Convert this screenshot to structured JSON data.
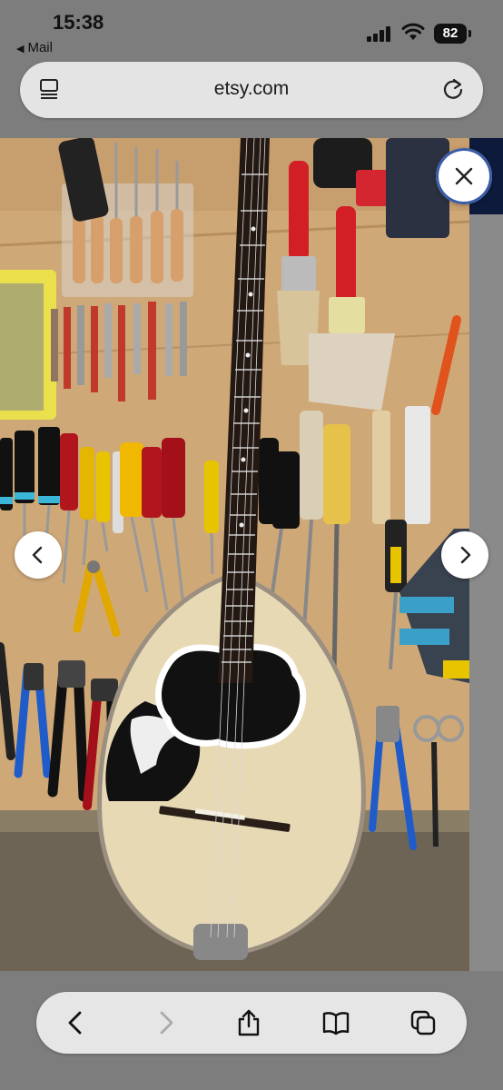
{
  "status": {
    "time": "15:38",
    "back_app": "Mail",
    "battery": "82"
  },
  "urlbar": {
    "url": "etsy.com",
    "left_icon": "reader-icon",
    "right_icon": "reload-icon"
  },
  "lightbox": {
    "image_subject": "bouzouki with eagle inlay in front of tool wall",
    "close_icon": "close-icon",
    "prev_icon": "chevron-left-icon",
    "next_icon": "chevron-right-icon"
  },
  "toolbar": {
    "icons": [
      "back-icon",
      "forward-icon",
      "share-icon",
      "bookmarks-icon",
      "tabs-icon"
    ]
  }
}
